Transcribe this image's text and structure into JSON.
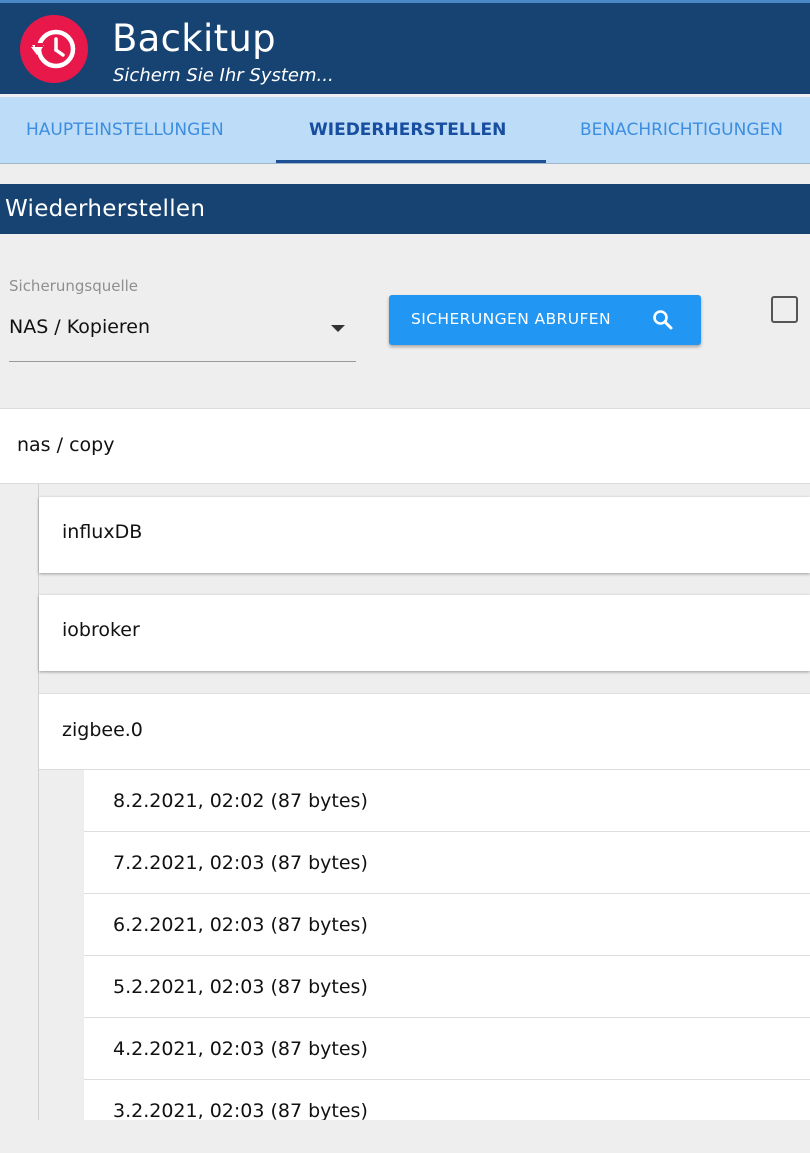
{
  "app": {
    "title": "Backitup",
    "subtitle": "Sichern Sie Ihr System...",
    "logo_icon": "history-clock-icon",
    "brand_color": "#174373",
    "logo_color": "#e8194a"
  },
  "tabs": [
    {
      "label": "HAUPTEINSTELLUNGEN",
      "active": false
    },
    {
      "label": "WIEDERHERSTELLEN",
      "active": true
    },
    {
      "label": "BENACHRICHTIGUNGEN",
      "active": false
    }
  ],
  "section": {
    "title": "Wiederherstellen"
  },
  "source": {
    "label": "Sicherungsquelle",
    "value": "NAS / Kopieren"
  },
  "fetch_button": {
    "label": "SICHERUNGEN ABRUFEN",
    "icon": "search-icon",
    "color": "#2196f3"
  },
  "tree": {
    "group": "nas / copy",
    "items": [
      {
        "label": "influxDB",
        "expanded": false
      },
      {
        "label": "iobroker",
        "expanded": false
      },
      {
        "label": "zigbee.0",
        "expanded": true
      }
    ],
    "files": [
      "8.2.2021, 02:02 (87 bytes)",
      "7.2.2021, 02:03 (87 bytes)",
      "6.2.2021, 02:03 (87 bytes)",
      "5.2.2021, 02:03 (87 bytes)",
      "4.2.2021, 02:03 (87 bytes)",
      "3.2.2021, 02:03 (87 bytes)"
    ]
  }
}
